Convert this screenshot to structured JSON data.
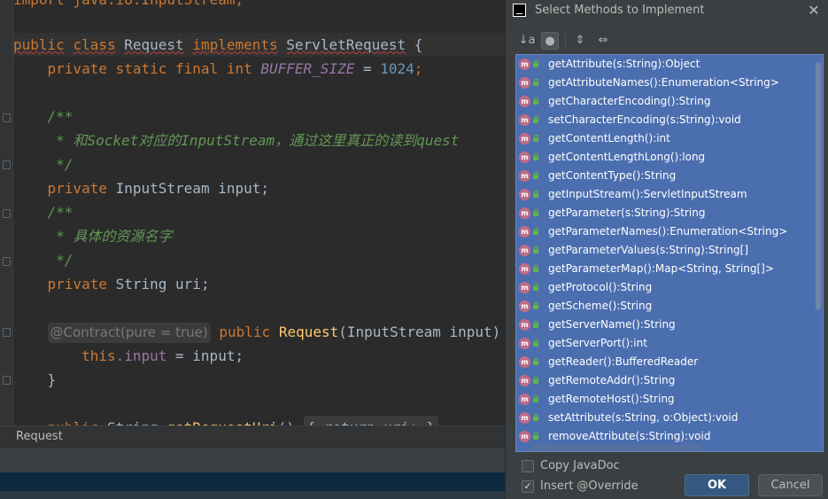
{
  "editor": {
    "lines": {
      "import": "import java.io.InputStream;",
      "class_public": "public",
      "class_class": "class",
      "class_name": "Request",
      "class_implements": "implements",
      "class_iface": "ServletRequest",
      "class_brace": "{",
      "f1_mods": "private static final",
      "f1_type": "int",
      "f1_name": "BUFFER_SIZE",
      "f1_eq": " = ",
      "f1_val": "1024",
      "f1_end": ";",
      "c1_open": "/**",
      "c1_text": " * 和Socket对应的InputStream，通过这里真正的读到quest",
      "c1_close": " */",
      "f2_mod": "private",
      "f2_rest": "InputStream input;",
      "c2_open": "/**",
      "c2_text": " * 具体的资源名字",
      "c2_close": " */",
      "f3_mod": "private",
      "f3_rest": "String uri;",
      "ctor_hint": "@Contract(pure = true)",
      "ctor_public": "public",
      "ctor_name": "Request",
      "ctor_rest": "(InputStream input)",
      "assign_this": "this",
      "assign_field": ".input",
      "assign_rest": " = input;",
      "close_brace": "}",
      "last_public": "public",
      "last_type": "String",
      "last_name": "getRequestUri",
      "last_parens": "()",
      "last_fold": "{ return uri; }"
    }
  },
  "breadcrumb": {
    "text": "Request"
  },
  "dialog": {
    "title": "Select Methods to Implement",
    "close_glyph": "✕",
    "toolbar": {
      "sort_glyph": "↓a",
      "toggle_glyph": "●",
      "expand_glyph": "⇕",
      "collapse_glyph": "⇔"
    },
    "method_icon_letter": "m",
    "methods": [
      "getAttribute(s:String):Object",
      "getAttributeNames():Enumeration<String>",
      "getCharacterEncoding():String",
      "setCharacterEncoding(s:String):void",
      "getContentLength():int",
      "getContentLengthLong():long",
      "getContentType():String",
      "getInputStream():ServletInputStream",
      "getParameter(s:String):String",
      "getParameterNames():Enumeration<String>",
      "getParameterValues(s:String):String[]",
      "getParameterMap():Map<String, String[]>",
      "getProtocol():String",
      "getScheme():String",
      "getServerName():String",
      "getServerPort():int",
      "getReader():BufferedReader",
      "getRemoteAddr():String",
      "getRemoteHost():String",
      "setAttribute(s:String, o:Object):void",
      "removeAttribute(s:String):void"
    ],
    "options": {
      "copy_javadoc": {
        "label": "Copy JavaDoc",
        "checked": false
      },
      "insert_override": {
        "label": "Insert @Override",
        "checked": true,
        "check_glyph": "✓"
      }
    },
    "ok_label": "OK",
    "cancel_label": "Cancel"
  }
}
